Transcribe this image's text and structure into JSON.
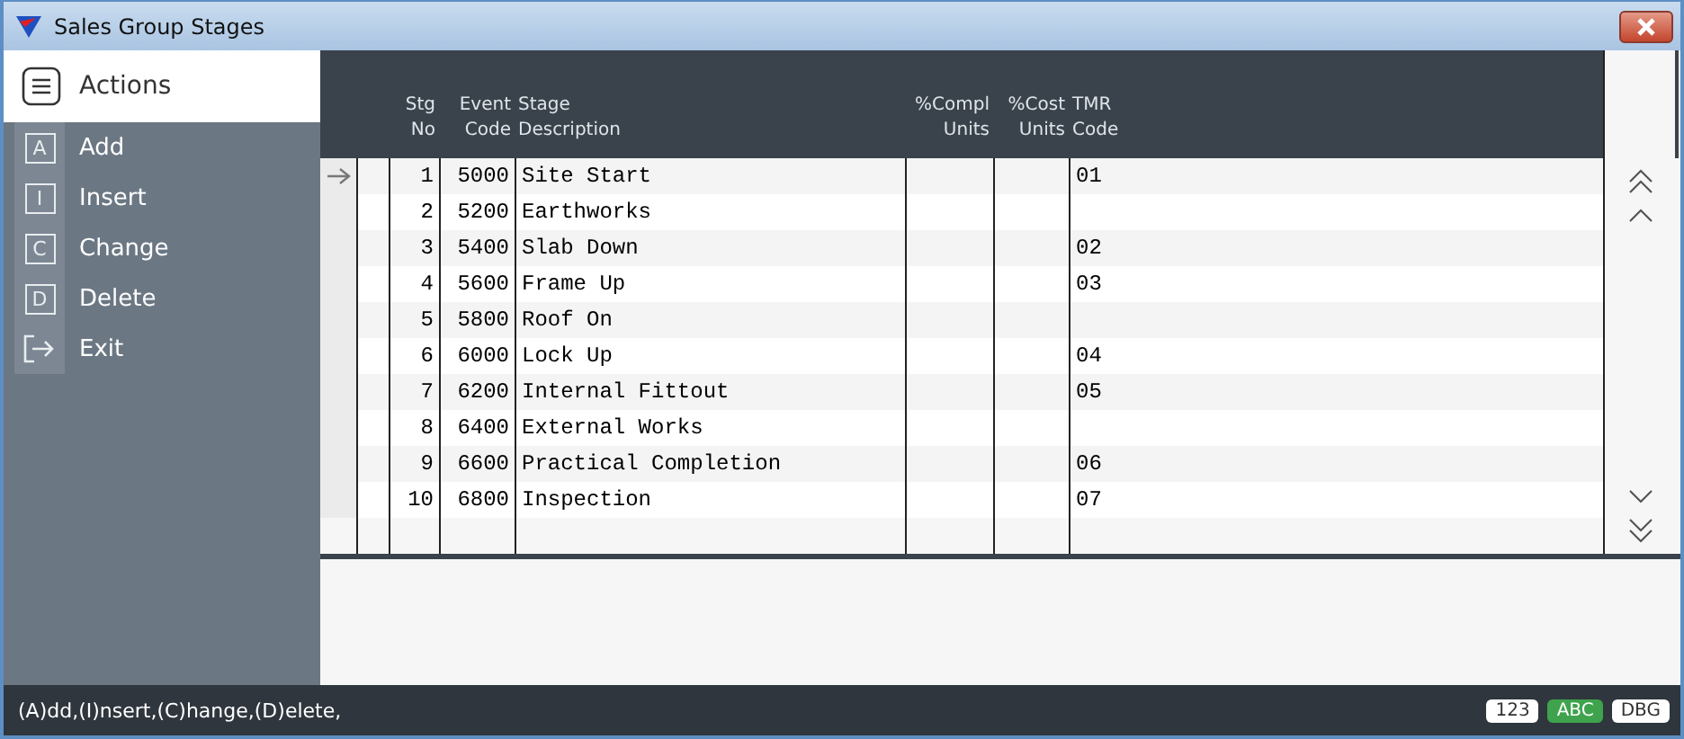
{
  "window": {
    "title": "Sales Group Stages"
  },
  "sidebar": {
    "title": "Actions",
    "items": [
      {
        "key": "A",
        "label": "Add",
        "kind": "letter"
      },
      {
        "key": "I",
        "label": "Insert",
        "kind": "letter"
      },
      {
        "key": "C",
        "label": "Change",
        "kind": "letter"
      },
      {
        "key": "D",
        "label": "Delete",
        "kind": "letter"
      },
      {
        "label": "Exit",
        "kind": "exit"
      }
    ]
  },
  "table": {
    "columns": [
      {
        "lines": [
          "Stg",
          "No"
        ]
      },
      {
        "lines": [
          "Event",
          "Code"
        ]
      },
      {
        "lines": [
          "Stage",
          "Description"
        ]
      },
      {
        "lines": [
          "%Compl",
          "Units"
        ]
      },
      {
        "lines": [
          "%Cost",
          "Units"
        ]
      },
      {
        "lines": [
          "TMR",
          "Code"
        ]
      }
    ],
    "rows": [
      {
        "current": true,
        "cells": [
          "1",
          "5000",
          "Site Start",
          "",
          "",
          "01"
        ]
      },
      {
        "current": false,
        "cells": [
          "2",
          "5200",
          "Earthworks",
          "",
          "",
          ""
        ]
      },
      {
        "current": false,
        "cells": [
          "3",
          "5400",
          "Slab Down",
          "",
          "",
          "02"
        ]
      },
      {
        "current": false,
        "cells": [
          "4",
          "5600",
          "Frame Up",
          "",
          "",
          "03"
        ]
      },
      {
        "current": false,
        "cells": [
          "5",
          "5800",
          "Roof On",
          "",
          "",
          ""
        ]
      },
      {
        "current": false,
        "cells": [
          "6",
          "6000",
          "Lock Up",
          "",
          "",
          "04"
        ]
      },
      {
        "current": false,
        "cells": [
          "7",
          "6200",
          "Internal Fittout",
          "",
          "",
          "05"
        ]
      },
      {
        "current": false,
        "cells": [
          "8",
          "6400",
          "External Works",
          "",
          "",
          ""
        ]
      },
      {
        "current": false,
        "cells": [
          "9",
          "6600",
          "Practical Completion",
          "",
          "",
          "06"
        ]
      },
      {
        "current": false,
        "cells": [
          "10",
          "6800",
          "Inspection",
          "",
          "",
          "07"
        ]
      }
    ]
  },
  "status_bar": {
    "text": "(A)dd,(I)nsert,(C)hange,(D)elete,",
    "badges": [
      {
        "label": "123",
        "on": false
      },
      {
        "label": "ABC",
        "on": true
      },
      {
        "label": "DBG",
        "on": false
      }
    ]
  }
}
